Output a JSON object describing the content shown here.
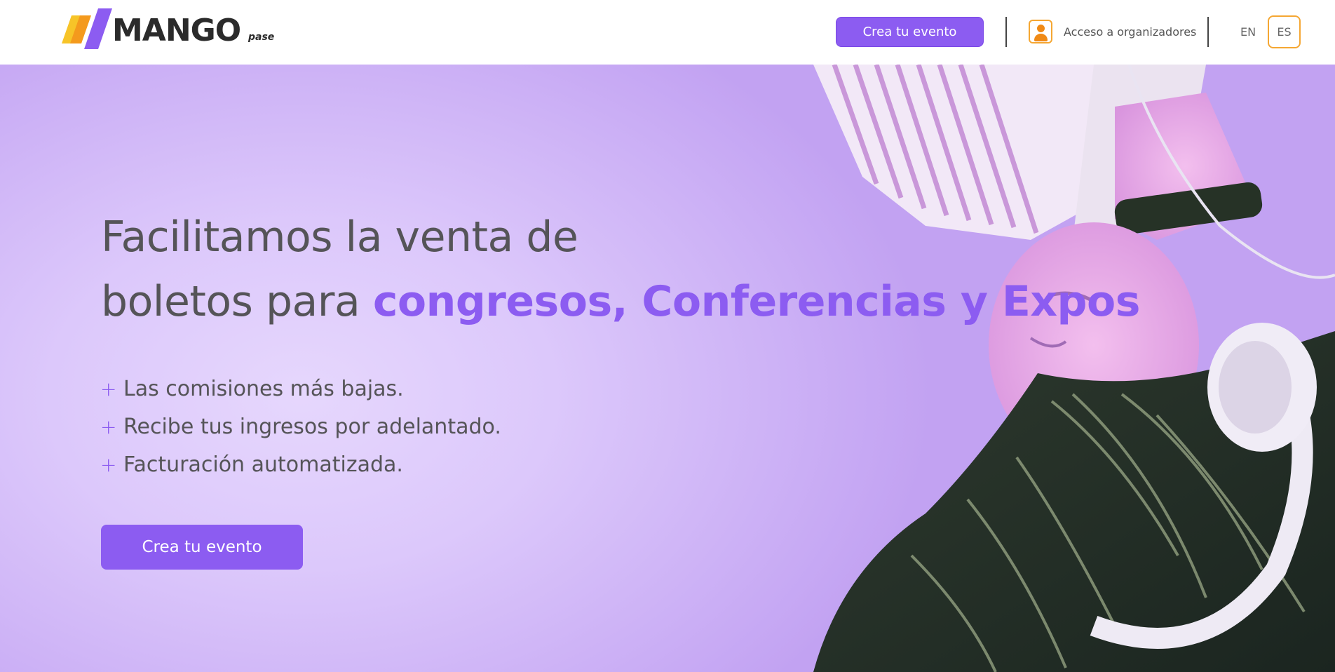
{
  "header": {
    "logo_text": "MANGO",
    "logo_sub": "pase",
    "cta_label": "Crea tu evento",
    "organizer_label": "Acceso a organizadores",
    "lang_en": "EN",
    "lang_es": "ES",
    "selected_language": "ES"
  },
  "hero": {
    "headline_line1": "Facilitamos la venta de",
    "headline_line2_plain": "boletos para ",
    "headline_line2_accent": "congresos, Conferencias y Expos",
    "benefits": [
      "Las comisiones más bajas.",
      "Recibe tus ingresos por adelantado.",
      "Facturación automatizada."
    ],
    "cta_label": "Crea tu evento"
  },
  "icons": {
    "logo": "mango-logo-icon",
    "organizer": "user-icon",
    "bullet": "plus-icon"
  },
  "colors": {
    "brand_purple": "#8c5cf1",
    "accent_orange": "#f5a733",
    "logo_yellow": "#f7c428",
    "hero_bg": "#dcc8fb"
  }
}
